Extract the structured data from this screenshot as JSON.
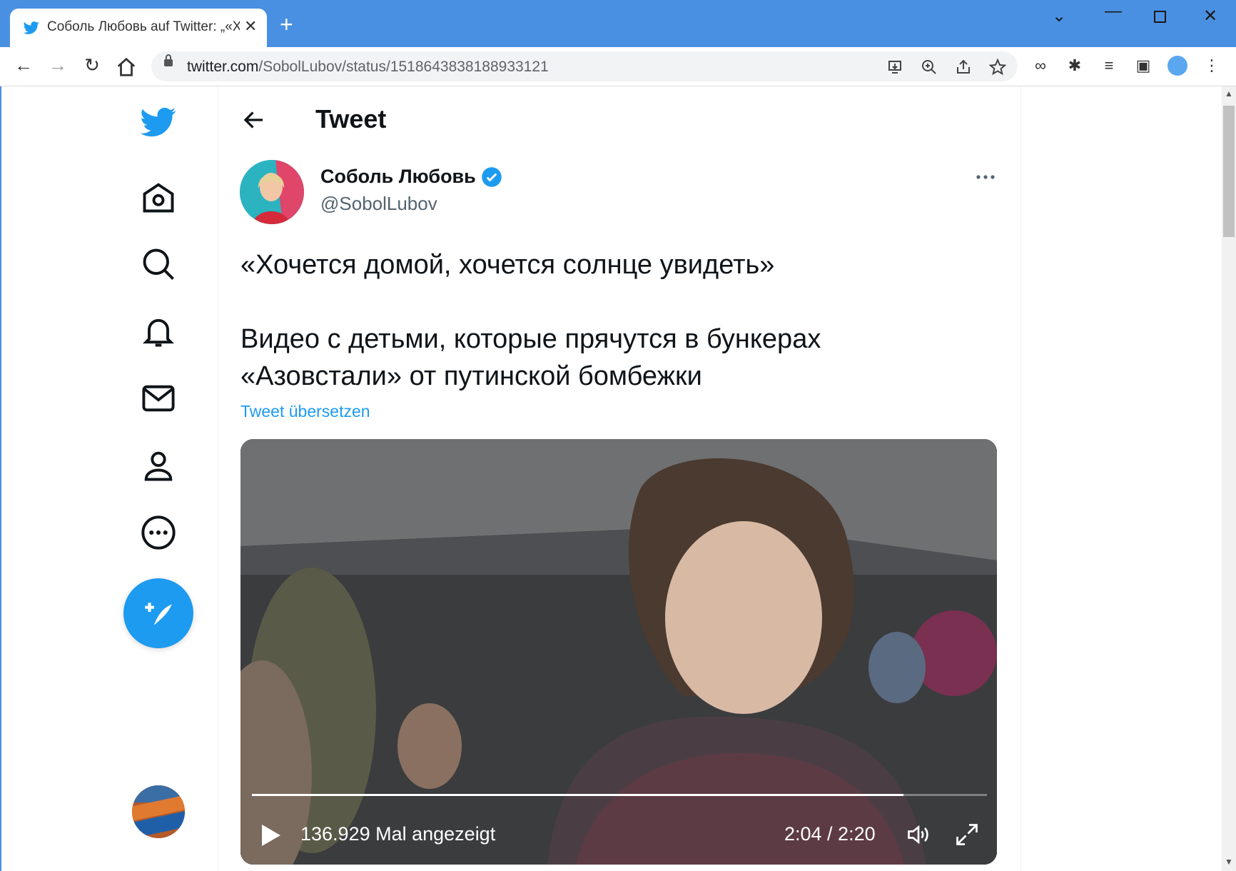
{
  "browser": {
    "tab_title": "Соболь Любовь auf Twitter: „«Xc",
    "url_host": "twitter.com",
    "url_path": "/SobolLubov/status/1518643838188933121"
  },
  "tweet": {
    "header_title": "Tweet",
    "author_name": "Соболь Любовь",
    "author_handle": "@SobolLubov",
    "paragraph1": "«Хочется домой, хочется солнце увидеть»",
    "paragraph2_line1": "Видео с детьми, которые прячутся в бункерах",
    "paragraph2_line2": "«Азовстали» от путинской бомбежки",
    "translate_link": "Tweet übersetzen"
  },
  "video": {
    "views": "136.929 Mal angezeigt",
    "time": "2:04 / 2:20",
    "progress": 0.886
  },
  "icons": [
    "twitter-logo-icon",
    "home-icon",
    "explore-icon",
    "notifications-icon",
    "messages-icon",
    "profile-icon",
    "more-icon",
    "compose-icon"
  ],
  "colors": {
    "twitter_blue": "#1d9bf0",
    "chrome_blue": "#4a90e2",
    "text": "#0f1419",
    "secondary": "#536471"
  }
}
